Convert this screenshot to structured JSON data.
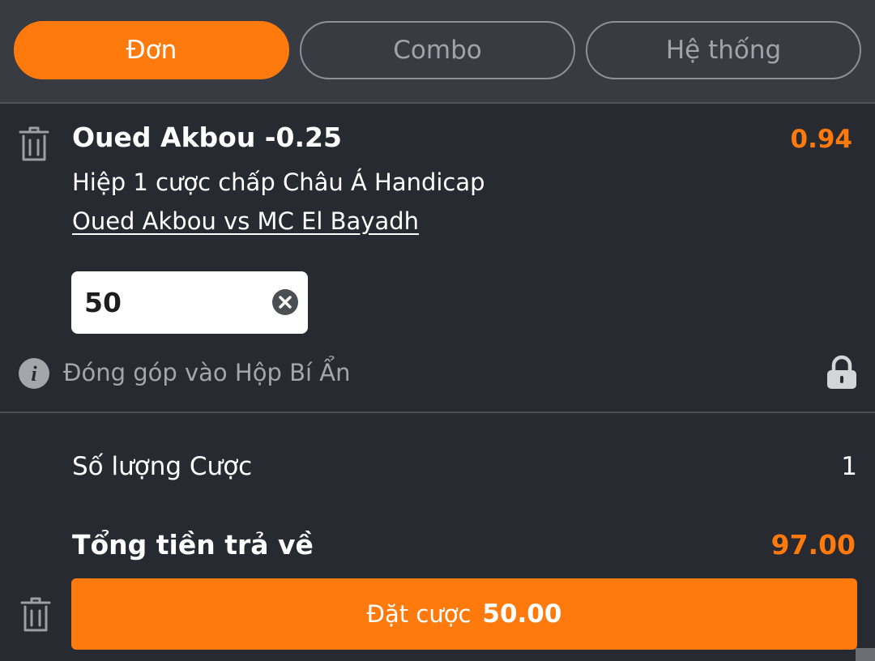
{
  "tabs": [
    {
      "label": "Đơn",
      "active": true
    },
    {
      "label": "Combo",
      "active": false
    },
    {
      "label": "Hệ thống",
      "active": false
    }
  ],
  "bet": {
    "selection": "Oued Akbou -0.25",
    "odds": "0.94",
    "market": "Hiệp 1 cược chấp Châu Á Handicap",
    "match": "Oued Akbou vs MC El Bayadh",
    "stake": "50"
  },
  "contribution": {
    "label": "Đóng góp vào Hộp Bí Ẩn"
  },
  "summary": {
    "bet_count_label": "Số lượng Cược",
    "bet_count": "1",
    "total_payout_label": "Tổng tiền trả về",
    "total_payout": "97.00"
  },
  "place_bet": {
    "label": "Đặt cược",
    "amount": "50.00"
  },
  "colors": {
    "accent": "#ff7a0d",
    "background": "#272a30",
    "header_background": "#383b42"
  },
  "icons": [
    "trash-icon",
    "clear-icon",
    "info-icon",
    "lock-icon"
  ]
}
